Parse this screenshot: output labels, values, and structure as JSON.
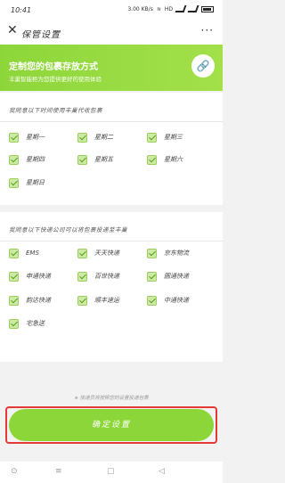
{
  "status_bar": {
    "time": "10:41",
    "speed": "3.00 KB/s",
    "network": "HD",
    "battery": ""
  },
  "nav": {
    "close_icon": "close-icon",
    "title": "保管设置",
    "more": "···"
  },
  "banner": {
    "heading": "定制您的包裹存放方式",
    "subtitle": "丰巢智能柜为您提供更好的使用体验",
    "link_icon": "link-icon"
  },
  "section_days": {
    "question": "我同意以下时间使用丰巢代收包裹",
    "options": [
      "星期一",
      "星期二",
      "星期三",
      "星期四",
      "星期五",
      "星期六",
      "星期日"
    ]
  },
  "section_couriers": {
    "question": "我同意以下快递公司可以将包裹投递至丰巢",
    "options": [
      "EMS",
      "天天快递",
      "京东物流",
      "申通快递",
      "百世快递",
      "圆通快递",
      "韵达快递",
      "顺丰速运",
      "中通快递",
      "宅急送"
    ]
  },
  "footer": {
    "tip": "※ 快递员将按照您的设置投递包裹",
    "confirm": "确定设置"
  },
  "sys_nav": {
    "a": "⊙",
    "b": "≡",
    "c": "▢",
    "d": "◁"
  },
  "colors": {
    "accent": "#8dd63a",
    "highlight": "#e53935"
  }
}
